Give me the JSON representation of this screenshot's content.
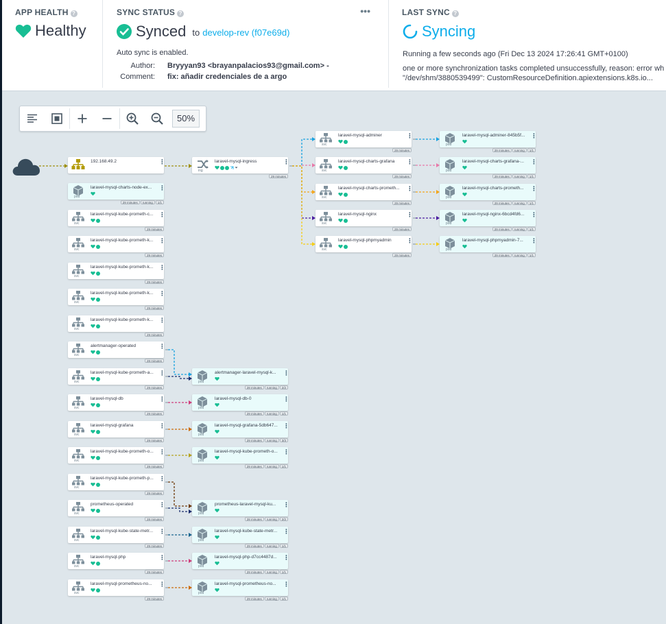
{
  "app_health": {
    "title": "APP HEALTH",
    "value": "Healthy",
    "help": "?"
  },
  "sync_status": {
    "title": "SYNC STATUS",
    "help": "?",
    "value": "Synced",
    "to": "to",
    "revision": "develop-rev (f07e69d)",
    "auto_sync": "Auto sync is enabled.",
    "author_label": "Author:",
    "author": "Bryyyan93 <brayanpalacios93@gmail.com> -",
    "comment_label": "Comment:",
    "comment": "fix: añadir credenciales de a argo",
    "menu": "•••"
  },
  "last_sync": {
    "title": "LAST SYNC",
    "help": "?",
    "value": "Syncing",
    "running": "Running a few seconds ago (Fri Dec 13 2024 17:26:41 GMT+0100)",
    "message_1": "one or more synchronization tasks completed unsuccessfully, reason: error wh",
    "message_2": "\"/dev/shm/3880539499\": CustomResourceDefinition.apiextensions.k8s.io..."
  },
  "toolbar": {
    "zoom": "50%"
  },
  "icons": {
    "toolbar": [
      "align-left-icon",
      "fit-screen-icon",
      "plus-icon",
      "minus-icon",
      "zoom-in-icon",
      "zoom-out-icon"
    ],
    "health": "heart-icon",
    "synced": "check-circle-icon",
    "syncing": "spinner-icon",
    "internet": "cloud-icon",
    "ingress": "ingress-shuffle-icon",
    "svc": "network-icon",
    "pod": "cube-icon",
    "ip": "network-hub-icon"
  },
  "colors": {
    "healthy": "#18be94",
    "link": "#0dadea",
    "edge_olive": "#9e8f10",
    "edge_blue": "#1aa3e0",
    "edge_pink": "#e879a9",
    "edge_orange": "#f3a51b",
    "edge_purple": "#4b1ca0",
    "edge_yellow": "#f5cd16",
    "edge_navy": "#1a2e6e",
    "edge_magenta": "#d03b7a",
    "edge_brown": "#cc6b08",
    "edge_olive2": "#b5a21e",
    "edge_darkbrown": "#6e3b0a",
    "edge_teal": "#19658e"
  },
  "graph": {
    "internet_node": "",
    "ip_node": {
      "label": "192.168.49.2"
    },
    "ingress_node": {
      "label": "laravel-mysql-ingress",
      "kind": "ing",
      "age": "29 minutes"
    },
    "ingress_svcs": [
      {
        "label": "laravel-mysql-adminer",
        "kind": "svc",
        "age": "29 minutes"
      },
      {
        "label": "laravel-mysql-charts-grafana",
        "kind": "svc",
        "age": "29 minutes"
      },
      {
        "label": "laravel-mysql-charts-prometh...",
        "kind": "svc",
        "age": "29 minutes"
      },
      {
        "label": "laravel-mysql-nginx",
        "kind": "svc",
        "age": "29 minutes"
      },
      {
        "label": "laravel-mysql-phpmyadmin",
        "kind": "svc",
        "age": "29 minutes"
      }
    ],
    "ingress_pods": [
      {
        "label": "laravel-mysql-adminer-845b5f...",
        "kind": "pod",
        "age": "29 minutes",
        "status": "running",
        "count": "1/1"
      },
      {
        "label": "laravel-mysql-charts-grafana-...",
        "kind": "pod",
        "age": "29 minutes",
        "status": "running",
        "count": "1/1"
      },
      {
        "label": "laravel-mysql-charts-prometh...",
        "kind": "pod",
        "age": "29 minutes",
        "status": "running",
        "count": "1/1"
      },
      {
        "label": "laravel-mysql-nginx-6bcd4fd6...",
        "kind": "pod",
        "age": "29 minutes",
        "status": "running",
        "count": "1/1"
      },
      {
        "label": "laravel-mysql-phpmyadmin-7...",
        "kind": "pod",
        "age": "29 minutes",
        "status": "running",
        "count": "1/1"
      }
    ],
    "left_nodes": [
      {
        "label": "laravel-mysql-charts-node-ex...",
        "kind": "pod",
        "age": "29 minutes",
        "status": "running",
        "count": "1/1"
      },
      {
        "label": "laravel-mysql-kube-prometh-c...",
        "kind": "svc",
        "age": "29 minutes"
      },
      {
        "label": "laravel-mysql-kube-prometh-k...",
        "kind": "svc",
        "age": "29 minutes"
      },
      {
        "label": "laravel-mysql-kube-prometh-k...",
        "kind": "svc",
        "age": "29 minutes"
      },
      {
        "label": "laravel-mysql-kube-prometh-k...",
        "kind": "svc",
        "age": "29 minutes"
      },
      {
        "label": "laravel-mysql-kube-prometh-k...",
        "kind": "svc",
        "age": "29 minutes"
      },
      {
        "label": "alertmanager-operated",
        "kind": "svc",
        "age": "28 minutes"
      },
      {
        "label": "laravel-mysql-kube-prometh-a...",
        "kind": "svc",
        "age": "29 minutes"
      },
      {
        "label": "laravel-mysql-db",
        "kind": "svc",
        "age": "29 minutes"
      },
      {
        "label": "laravel-mysql-grafana",
        "kind": "svc",
        "age": "29 minutes"
      },
      {
        "label": "laravel-mysql-kube-prometh-o...",
        "kind": "svc",
        "age": "29 minutes"
      },
      {
        "label": "laravel-mysql-kube-prometh-p...",
        "kind": "svc",
        "age": "29 minutes"
      },
      {
        "label": "prometheus-operated",
        "kind": "svc",
        "age": "28 minutes"
      },
      {
        "label": "laravel-mysql-kube-state-metr...",
        "kind": "svc",
        "age": "29 minutes"
      },
      {
        "label": "laravel-mysql-php",
        "kind": "svc",
        "age": "29 minutes"
      },
      {
        "label": "laravel-mysql-prometheus-no...",
        "kind": "svc",
        "age": "29 minutes"
      }
    ],
    "mid_pods": [
      {
        "label": "alertmanager-laravel-mysql-k...",
        "kind": "pod",
        "age": "28 minutes",
        "status": "running",
        "count": "2/2"
      },
      {
        "label": "laravel-mysql-db-0",
        "kind": "pod",
        "age": "29 minutes",
        "status": "running",
        "count": "1/1"
      },
      {
        "label": "laravel-mysql-grafana-5db647...",
        "kind": "pod",
        "age": "29 minutes",
        "status": "running",
        "count": "3/3"
      },
      {
        "label": "laravel-mysql-kube-prometh-o...",
        "kind": "pod",
        "age": "29 minutes",
        "status": "running",
        "count": "1/1"
      },
      {
        "label": "prometheus-laravel-mysql-ku...",
        "kind": "pod",
        "age": "28 minutes",
        "status": "running",
        "count": "2/2"
      },
      {
        "label": "laravel-mysql-kube-state-metr...",
        "kind": "pod",
        "age": "29 minutes",
        "status": "running",
        "count": "1/1"
      },
      {
        "label": "laravel-mysql-php-d7cc4487d...",
        "kind": "pod",
        "age": "29 minutes",
        "status": "running",
        "count": "1/1"
      },
      {
        "label": "laravel-mysql-prometheus-no...",
        "kind": "pod",
        "age": "29 minutes",
        "status": "running",
        "count": "1/1"
      }
    ]
  }
}
